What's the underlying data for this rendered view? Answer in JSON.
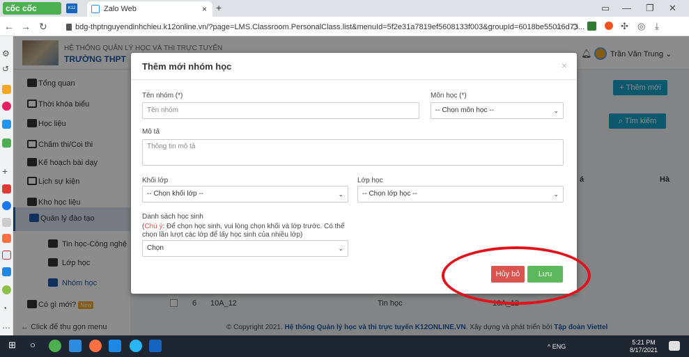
{
  "browser": {
    "brand": "cốc cốc",
    "tab_title": "Zalo Web",
    "tab_close": "×",
    "new_tab": "+",
    "url": "bdg-thptnguyendinhchieu.k12online.vn/?page=LMS.Classroom.PersonalClass.list&menuId=5f2e31a7819ef5608133f003&groupId=6018be55016d73..."
  },
  "header": {
    "system_title": "HỆ THỐNG QUẢN LÝ HỌC VÀ THI TRỰC TUYẾN",
    "school": "TRƯỜNG THPT",
    "user_name": "Trần Văn Trung"
  },
  "sidebar": {
    "items": [
      {
        "label": "Tổng quan"
      },
      {
        "label": "Thời khóa biểu"
      },
      {
        "label": "Học liệu"
      },
      {
        "label": "Chấm thi/Coi thi"
      },
      {
        "label": "Kế hoạch bài dạy"
      },
      {
        "label": "Lịch sự kiện"
      },
      {
        "label": "Kho học liệu"
      },
      {
        "label": "Quản lý đào tạo"
      },
      {
        "label": "Tin học-Công nghệ"
      },
      {
        "label": "Lớp học"
      },
      {
        "label": "Nhóm học"
      },
      {
        "label": "Có gì mới?"
      }
    ],
    "new_badge": "New",
    "collapse_label": "Click để thu gọn menu"
  },
  "main": {
    "add_button": "+ Thêm mới",
    "search_button": "Tìm kiếm",
    "col_a": "á",
    "col_ha": "Hà",
    "row6": {
      "index": "6",
      "name": "10A_12",
      "subject": "Tin học",
      "class": "10A_12"
    }
  },
  "footer": {
    "copyright_prefix": "© Copyright 2021.",
    "system_name": "Hệ thống Quản lý học và thi trực tuyến K12ONLINE.VN",
    "built_by": ". Xây dựng và phát triển bởi",
    "company": "Tập đoàn Viettel"
  },
  "modal": {
    "title": "Thêm mới nhóm học",
    "close": "×",
    "group_name_label": "Tên nhóm (*)",
    "group_name_placeholder": "Tên nhóm",
    "subject_label": "Môn học (*)",
    "subject_value": "-- Chọn môn học --",
    "description_label": "Mô tả",
    "description_placeholder": "Thông tin mô tả",
    "grade_label": "Khối lớp",
    "grade_value": "-- Chọn khối lớp --",
    "class_label": "Lớp học",
    "class_value": "-- Chọn lớp học --",
    "students_label": "Danh sách học sinh",
    "note_prefix": "(",
    "note_warn": "Chú ý",
    "note_text": ": Để chọn học sinh, vui lòng chọn khối và lớp trước. Có thể chọn lần lượt các lớp để lấy học sinh của nhiều lớp)",
    "students_value": "Chọn",
    "cancel": "Hủy bỏ",
    "save": "Lưu"
  },
  "taskbar": {
    "tray": "^  ENG",
    "time": "5:21 PM",
    "date": "8/17/2021"
  },
  "colors": {
    "accent": "#1e5aa8",
    "primary_btn": "#17a2c9",
    "danger": "#d9534f",
    "success": "#5cb85c",
    "highlight_circle": "#e2111a"
  }
}
